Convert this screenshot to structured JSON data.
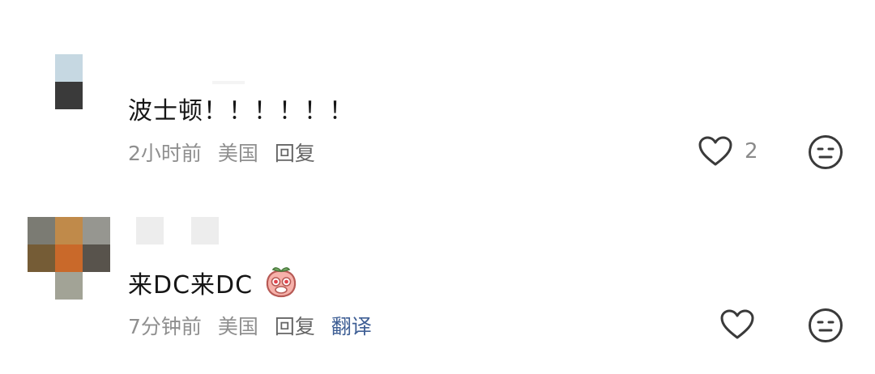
{
  "comments": [
    {
      "text": "波士顿！！！！！！",
      "time": "2小时前",
      "location": "美国",
      "reply_label": "回复",
      "like_count": "2"
    },
    {
      "text": "来DC来DC",
      "time": "7分钟前",
      "location": "美国",
      "reply_label": "回复",
      "translate_label": "翻译",
      "emoji": "peach-face-emoji"
    }
  ],
  "icons": {
    "like": "heart-outline-icon",
    "dislike": "neutral-face-icon"
  },
  "colors": {
    "text": "#161616",
    "meta": "#8f8f8f",
    "translate": "#3f5f95",
    "icon": "#3a3a3a"
  }
}
